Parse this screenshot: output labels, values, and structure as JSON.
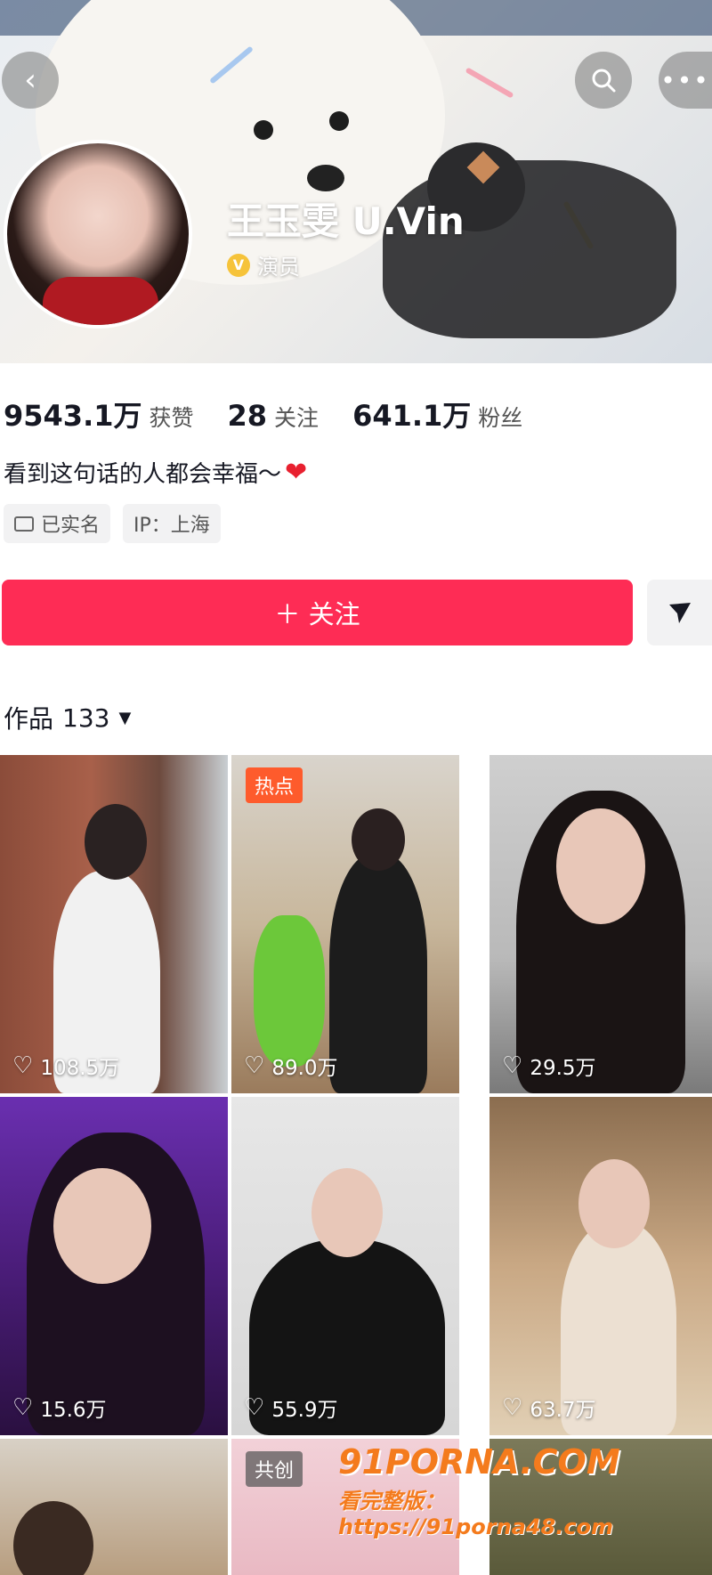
{
  "profile": {
    "name": "王玉雯 U.Vin",
    "verify_badge": "V",
    "verify_title": "演员",
    "bio": "看到这句话的人都会幸福～",
    "bio_emoji": "❤"
  },
  "stats": [
    {
      "value": "9543.1万",
      "label": "获赞"
    },
    {
      "value": "28",
      "label": "关注"
    },
    {
      "value": "641.1万",
      "label": "粉丝"
    }
  ],
  "tags": [
    {
      "icon": "id-card-icon",
      "label": "已实名"
    },
    {
      "label": "IP：上海"
    }
  ],
  "actions": {
    "follow_label": "＋ 关注",
    "share_icon": "send-icon",
    "back_icon": "back-chevron-icon",
    "search_icon": "search-icon",
    "more_icon": "more-dots-icon"
  },
  "works": {
    "label": "作品",
    "count": "133",
    "dropdown_icon": "caret-down-icon"
  },
  "videos": [
    {
      "likes": "108.5万"
    },
    {
      "likes": "89.0万",
      "badge": "热点"
    },
    {
      "likes": "29.5万"
    },
    {
      "likes": "15.6万"
    },
    {
      "likes": "55.9万"
    },
    {
      "likes": "63.7万"
    },
    {
      "likes": ""
    },
    {
      "likes": "",
      "badge": "共创"
    },
    {
      "likes": ""
    }
  ],
  "watermark": {
    "brand": "91PORNA.COM",
    "text": "看完整版：https://91porna48.com"
  },
  "colors": {
    "accent": "#fe2c55",
    "verify": "#f6c33a",
    "hot_badge": "#fe5b2c"
  }
}
